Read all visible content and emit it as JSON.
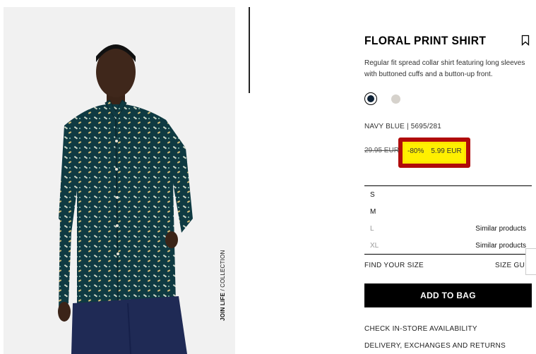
{
  "gallery": {
    "caption_bold": "JOIN LIFE",
    "caption_rest": " / COLLECTION"
  },
  "product": {
    "title": "FLORAL PRINT SHIRT",
    "description": "Regular fit spread collar shirt featuring long sleeves with buttoned cuffs and a button-up front.",
    "colors": [
      {
        "name": "navy",
        "hex": "#0e2236",
        "selected": true
      },
      {
        "name": "grey",
        "hex": "#d6d2cc",
        "selected": false
      }
    ],
    "color_ref": "NAVY BLUE | 5695/281",
    "old_price": "29.95 EUR",
    "discount": "-80%",
    "new_price": "5.99 EUR",
    "highlight_colors": {
      "frame": "#b00b0b",
      "fill": "#fff000"
    }
  },
  "sizes": [
    {
      "label": "S",
      "available": true,
      "note": ""
    },
    {
      "label": "M",
      "available": true,
      "note": ""
    },
    {
      "label": "L",
      "available": false,
      "note": "Similar products"
    },
    {
      "label": "XL",
      "available": false,
      "note": "Similar products"
    }
  ],
  "size_links": {
    "find_your_size": "FIND YOUR SIZE",
    "size_guide": "SIZE GUID"
  },
  "actions": {
    "add_to_bag": "ADD TO BAG",
    "check_store": "CHECK IN-STORE AVAILABILITY",
    "delivery": "DELIVERY, EXCHANGES AND RETURNS"
  }
}
